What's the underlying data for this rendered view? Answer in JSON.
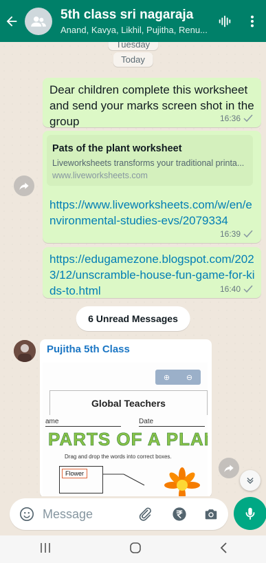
{
  "header": {
    "title": "5th class sri nagaraja",
    "subtitle": "Anand, Kavya, Likhil, Pujitha, Renu..."
  },
  "chat": {
    "date_partial": "Tuesday",
    "date_today": "Today",
    "messages": [
      {
        "text": "Dear children complete this worksheet and send your marks screen shot in the group",
        "time": "16:36"
      },
      {
        "preview_title": "Pats of the plant worksheet",
        "preview_desc": "Liveworksheets transforms your traditional printa...",
        "preview_domain": "www.liveworksheets.com",
        "link": "https://www.liveworksheets.com/w/en/environmental-studies-evs/2079334",
        "time": "16:39"
      },
      {
        "link": "https://edugamezone.blogspot.com/2023/12/unscramble-house-fun-game-for-kids-to.html",
        "time": "16:40"
      }
    ],
    "unread_label": "6 Unread Messages",
    "incoming": {
      "sender": "Pujitha 5th Class",
      "image": {
        "card_title": "Global Teachers",
        "field_name": "ame",
        "field_date": "Date",
        "heading": "PARTS OF A PLANT",
        "instruction": "Drag and drop the words into correct boxes.",
        "flower_label": "Flower"
      }
    }
  },
  "composer": {
    "placeholder": "Message"
  },
  "colors": {
    "header": "#008069",
    "outgoing_bubble": "#dcf8c6",
    "link": "#027eb5",
    "mic": "#00a884"
  }
}
